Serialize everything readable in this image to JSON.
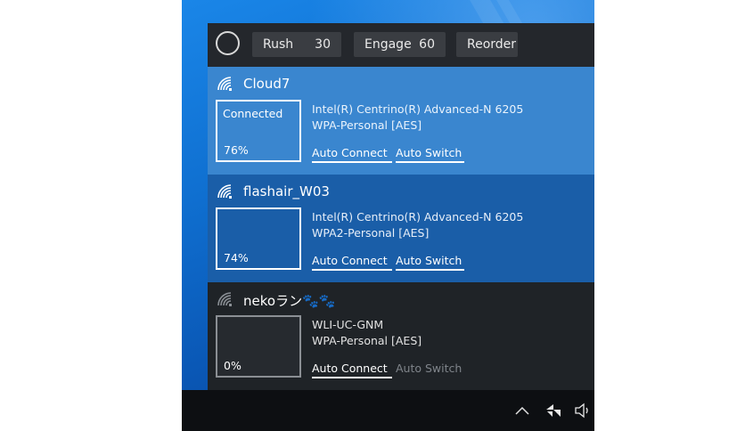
{
  "toolbar": {
    "circle_icon": "circle-icon",
    "rush": {
      "label": "Rush",
      "value": "30"
    },
    "engage": {
      "label": "Engage",
      "value": "60"
    },
    "reorder": {
      "label": "Reorder"
    }
  },
  "networks": [
    {
      "ssid": "Cloud7",
      "status": "Connected",
      "signal": "76%",
      "adapter": "Intel(R) Centrino(R) Advanced-N 6205",
      "security": "WPA-Personal [AES]",
      "auto_connect": "Auto Connect",
      "auto_switch": "Auto Switch",
      "auto_connect_on": true,
      "auto_switch_on": true,
      "icon": "wifi-icon",
      "bg": "#3a86cf"
    },
    {
      "ssid": "flashair_W03",
      "status": "",
      "signal": "74%",
      "adapter": "Intel(R) Centrino(R) Advanced-N 6205",
      "security": "WPA2-Personal [AES]",
      "auto_connect": "Auto Connect",
      "auto_switch": "Auto Switch",
      "auto_connect_on": true,
      "auto_switch_on": true,
      "icon": "wifi-icon",
      "bg": "#1a5ea8"
    },
    {
      "ssid": "nekoラン🐾🐾",
      "status": "",
      "signal": "0%",
      "adapter": "WLI-UC-GNM",
      "security": "WPA-Personal [AES]",
      "auto_connect": "Auto Connect",
      "auto_switch": "Auto Switch",
      "auto_connect_on": true,
      "auto_switch_on": false,
      "icon": "wifi-icon",
      "bg": "#1f2327"
    }
  ],
  "taskbar": {
    "icons": [
      "chevron-up-icon",
      "network-icon",
      "speaker-icon"
    ]
  }
}
